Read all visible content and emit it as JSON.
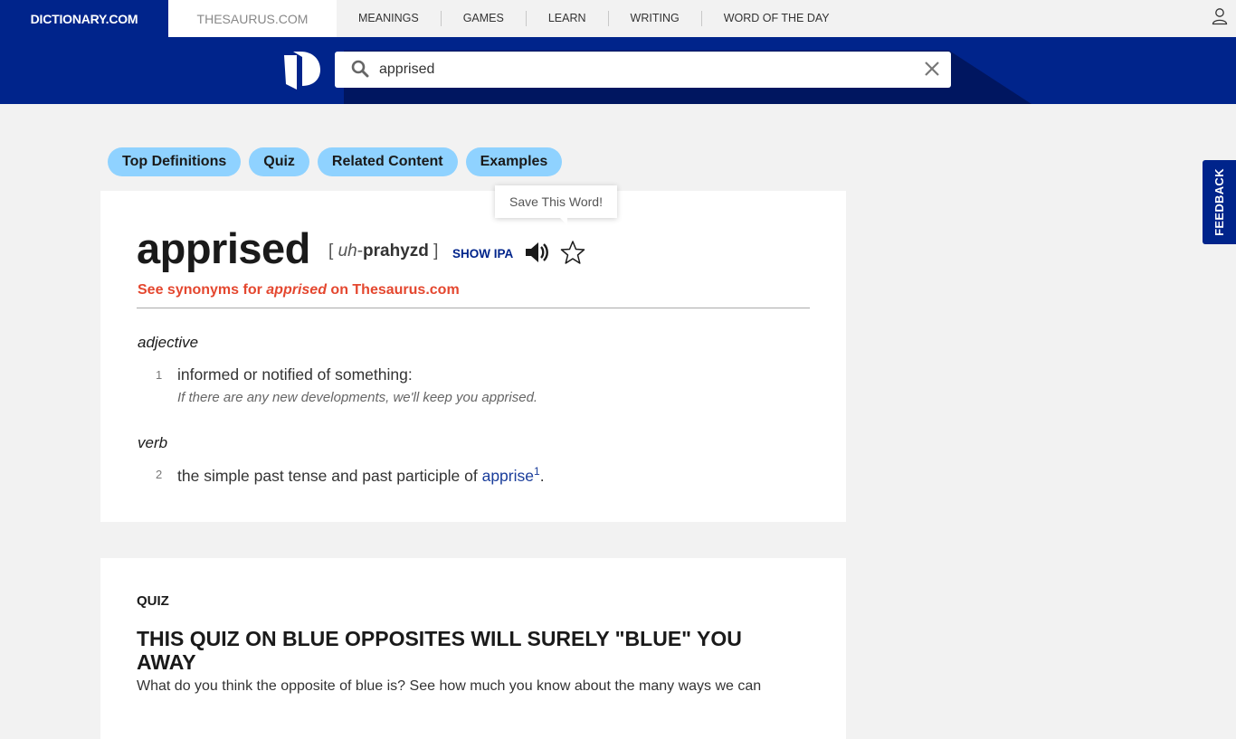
{
  "topnav": {
    "brand": "DICTIONARY.COM",
    "thesaurus": "THESAURUS.COM",
    "links": [
      "MEANINGS",
      "GAMES",
      "LEARN",
      "WRITING",
      "WORD OF THE DAY"
    ],
    "user_icon": "user-icon"
  },
  "search": {
    "value": "apprised",
    "placeholder": "",
    "search_icon": "search-icon",
    "clear_icon": "close-icon"
  },
  "pills": [
    "Top Definitions",
    "Quiz",
    "Related Content",
    "Examples"
  ],
  "entry": {
    "headword": "apprised",
    "pron_open": "[ ",
    "pron_italic": "uh",
    "pron_sep": "-",
    "pron_bold": "prahyzd",
    "pron_close": " ]",
    "show_ipa": "SHOW IPA",
    "tooltip": "Save This Word!",
    "synonyms_prefix": "See synonyms for ",
    "synonyms_word": "apprised",
    "synonyms_suffix": " on Thesaurus.com",
    "senses": [
      {
        "pos": "adjective",
        "num": "1",
        "text": "informed or notified of something:",
        "example": "If there are any new developments, we'll keep you apprised."
      },
      {
        "pos": "verb",
        "num": "2",
        "text_prefix": "the simple past tense and past participle of ",
        "link": "apprise",
        "sup": "1",
        "text_suffix": "."
      }
    ]
  },
  "quiz": {
    "label": "QUIZ",
    "title": "THIS QUIZ ON BLUE OPPOSITES WILL SURELY \"BLUE\" YOU AWAY",
    "description": "What do you think the opposite of blue is? See how much you know about the many ways we can"
  },
  "feedback": "FEEDBACK",
  "colors": {
    "brand_blue": "#00248b",
    "pill": "#8fd2ff",
    "accent_red": "#e4472f",
    "link_blue": "#1a3d9b"
  }
}
